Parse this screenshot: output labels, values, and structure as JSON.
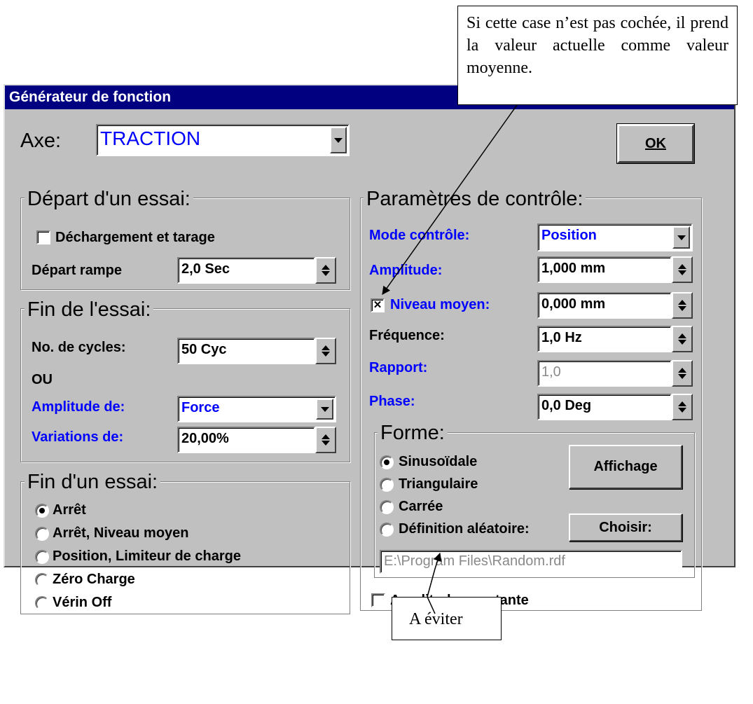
{
  "window": {
    "title": "Générateur de fonction",
    "ok_label": "OK"
  },
  "axis": {
    "label": "Axe:",
    "value": "TRACTION"
  },
  "start_group": {
    "legend": "Départ d'un essai:",
    "unload_label": "Déchargement et tarage",
    "unload_checked": false,
    "ramp_label": "Départ rampe",
    "ramp_value": "2,0 Sec"
  },
  "end_test_group": {
    "legend": "Fin de l'essai:",
    "cycles_label": "No. de cycles:",
    "cycles_value": "50 Cyc",
    "or_label": "OU",
    "amplitude_label": "Amplitude de:",
    "amplitude_value": "Force",
    "variations_label": "Variations de:",
    "variations_value": "20,00%"
  },
  "end_action_group": {
    "legend": "Fin d'un essai:",
    "options": [
      "Arrêt",
      "Arrêt, Niveau moyen",
      "Position, Limiteur de charge",
      "Zéro Charge",
      "Vérin Off"
    ],
    "selected": "Arrêt"
  },
  "control_group": {
    "legend": "Paramètres de contrôle:",
    "mode_label": "Mode contrôle:",
    "mode_value": "Position",
    "amplitude_label": "Amplitude:",
    "amplitude_value": "1,000 mm",
    "mean_label": "Niveau moyen:",
    "mean_value": "0,000 mm",
    "mean_checked": true,
    "frequency_label": "Fréquence:",
    "frequency_value": "1,0 Hz",
    "ratio_label": "Rapport:",
    "ratio_value": "1,0",
    "phase_label": "Phase:",
    "phase_value": "0,0 Deg",
    "constant_amplitude_label": "Amplitude constante",
    "constant_amplitude_checked": false
  },
  "shape_group": {
    "legend": "Forme:",
    "options": [
      "Sinusoïdale",
      "Triangulaire",
      "Carrée",
      "Définition aléatoire:"
    ],
    "selected": "Sinusoïdale",
    "display_button": "Affichage",
    "choose_button": "Choisir:",
    "random_file": "E:\\Program Files\\Random.rdf"
  },
  "annotations": {
    "checkbox_note": "Si cette case n’est pas cochée, il prend la valeur actuelle comme valeur moyenne.",
    "avoid_note": "A éviter"
  }
}
